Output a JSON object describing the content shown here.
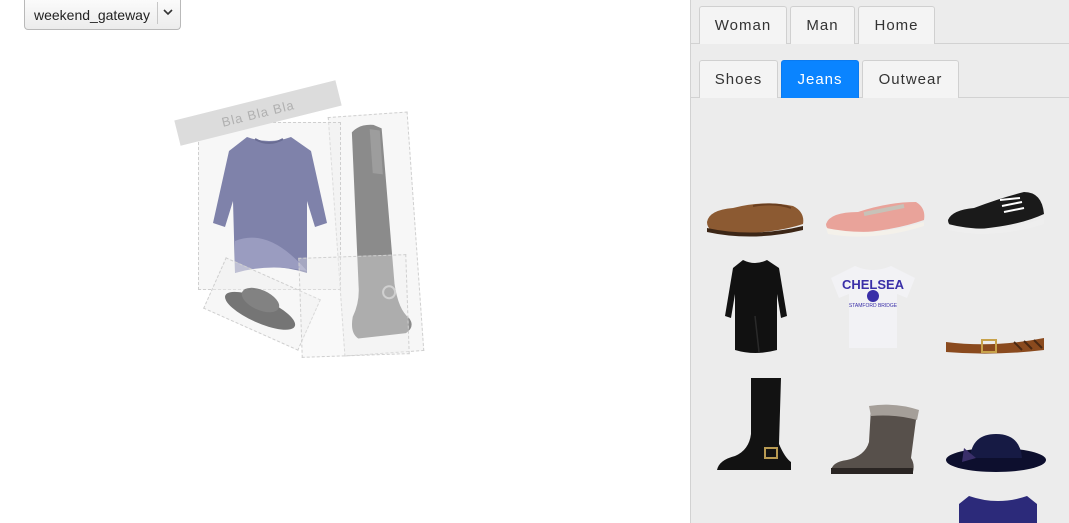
{
  "canvas": {
    "outfit_selector": {
      "value": "weekend_gateway",
      "icon": "chevron-down-icon"
    },
    "banner_text": "Bla Bla Bla"
  },
  "panel": {
    "category_tabs": [
      {
        "label": "Woman",
        "active": false
      },
      {
        "label": "Man",
        "active": false
      },
      {
        "label": "Home",
        "active": false
      }
    ],
    "subcategory_tabs": [
      {
        "label": "Shoes",
        "active": false
      },
      {
        "label": "Jeans",
        "active": true
      },
      {
        "label": "Outwear",
        "active": false
      }
    ],
    "products": [
      {
        "name": "brown-loafer"
      },
      {
        "name": "pink-slip-on"
      },
      {
        "name": "black-sneaker"
      },
      {
        "name": "black-dress"
      },
      {
        "name": "chelsea-tshirt",
        "print": "CHELSEA",
        "subprint": "STAMFORD BRIDGE"
      },
      {
        "name": "brown-belt"
      },
      {
        "name": "black-tall-boot"
      },
      {
        "name": "grey-fur-boot"
      },
      {
        "name": "navy-hat"
      },
      {
        "name": "purple-top"
      }
    ]
  },
  "colors": {
    "accent": "#0a84ff",
    "panel_bg": "#ececec"
  }
}
